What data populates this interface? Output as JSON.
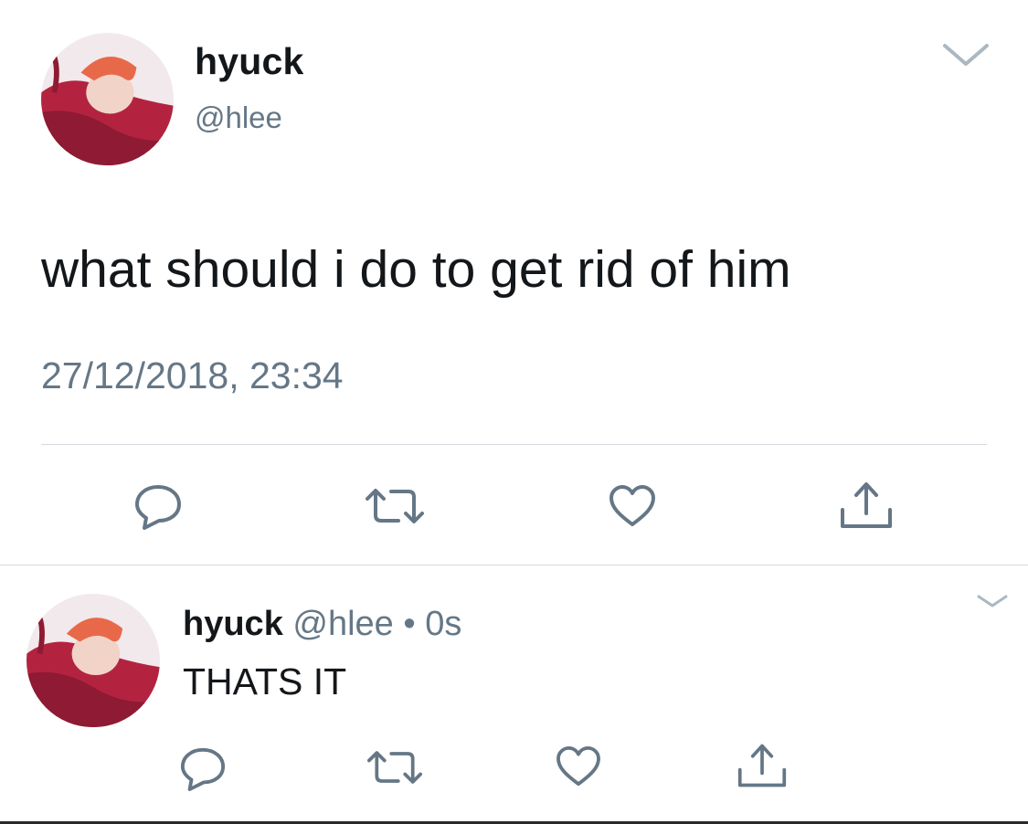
{
  "colors": {
    "text_primary": "#14171a",
    "text_secondary": "#657786",
    "divider": "#d6dbdf",
    "icon": "#657786",
    "avatar_red": "#b3233f",
    "avatar_hair": "#e8694a"
  },
  "main_tweet": {
    "display_name": "hyuck",
    "handle": "@hlee",
    "text": "what should i do to get rid of him",
    "timestamp": "27/12/2018, 23:34",
    "menu_icon": "chevron-down-icon",
    "actions": {
      "reply_icon": "reply-icon",
      "retweet_icon": "retweet-icon",
      "like_icon": "heart-icon",
      "share_icon": "share-icon"
    }
  },
  "reply_tweet": {
    "display_name": "hyuck",
    "handle": "@hlee",
    "separator": "•",
    "time_ago": "0s",
    "text": "THATS IT",
    "menu_icon": "chevron-down-icon",
    "actions": {
      "reply_icon": "reply-icon",
      "retweet_icon": "retweet-icon",
      "like_icon": "heart-icon",
      "share_icon": "share-icon"
    }
  }
}
